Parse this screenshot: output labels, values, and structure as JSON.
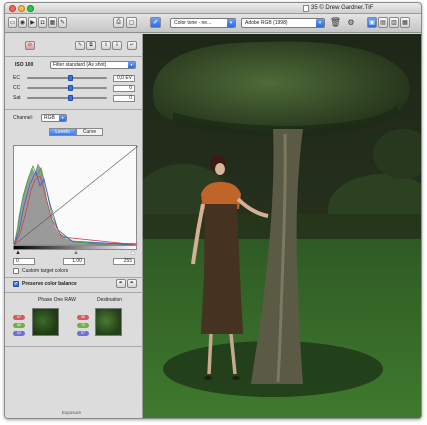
{
  "window": {
    "title": "35 © Drew Gardner.TIF"
  },
  "toolbar": {
    "color_mode_label": "Color tone - ne...",
    "color_profile_label": "Adobe RGB (1998)",
    "icons": [
      "folder-icon",
      "capture-icon",
      "film-icon",
      "camera-icon",
      "grid-icon",
      "pencil-icon",
      "print-icon",
      "frame-icon",
      "edit-icon",
      "trash-icon",
      "link-icon",
      "view-single-icon",
      "view-multi-icon",
      "view-grid-icon",
      "view-list-icon"
    ]
  },
  "left_panel": {
    "iso_label": "ISO 100",
    "filter_label": "Filter standard (As shot)",
    "sliders": [
      {
        "label": "EC",
        "value": "0,0 EV",
        "position": 0.55
      },
      {
        "label": "CC",
        "value": "0",
        "position": 0.55
      },
      {
        "label": "Sat",
        "value": "0",
        "position": 0.55
      }
    ],
    "channel_label": "Channel:",
    "channel_value": "RGB",
    "tabs": [
      "Levels",
      "Curve"
    ],
    "levels": {
      "black": "0",
      "gamma": "1.00",
      "white": "255"
    },
    "custom_target_label": "Custom target colors",
    "custom_target_checked": false,
    "preserve_color_label": "Preserve color balance",
    "preserve_color_checked": true,
    "phase_one_label": "Phase One RAW",
    "destination_label": "Destination",
    "source_values": [
      "67",
      "60",
      "63"
    ],
    "destination_values": [
      "58",
      "70",
      "57"
    ],
    "footer_label": "Exposure"
  },
  "colors": {
    "accent": "#2e6be0",
    "panel_bg": "#dcdcdc"
  }
}
